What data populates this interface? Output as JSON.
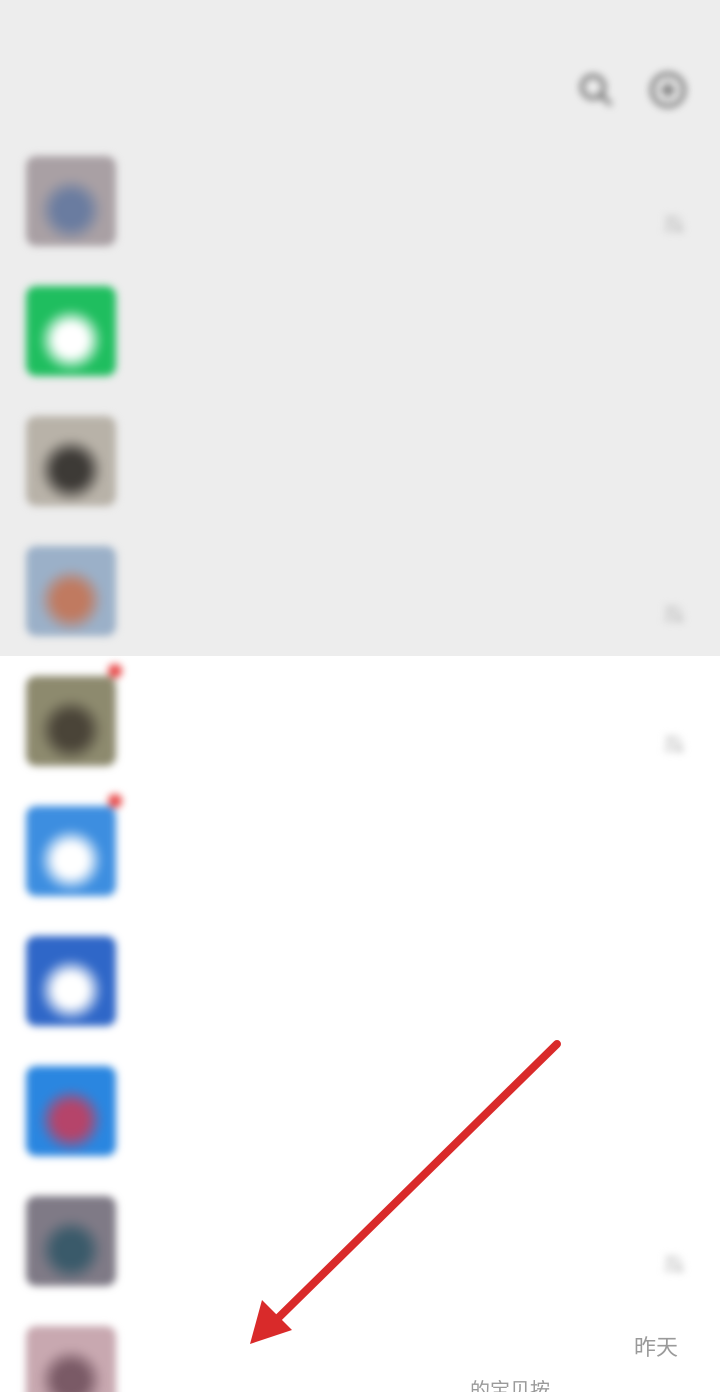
{
  "status_bar": {
    "time": "",
    "right": ""
  },
  "header": {
    "title": "",
    "back": ""
  },
  "chats": [
    {
      "name": "",
      "preview": "",
      "time": "",
      "pinned": true,
      "muted": true,
      "avatar_color": "#a9a0a4",
      "avatar_accent": "#6a7ca0"
    },
    {
      "name": "",
      "preview": "",
      "time": "",
      "pinned": true,
      "muted": false,
      "avatar_color": "#1fbe5f",
      "avatar_accent": "#ffffff"
    },
    {
      "name": "",
      "preview": "",
      "time": "",
      "pinned": true,
      "muted": false,
      "avatar_color": "#b8b2a8",
      "avatar_accent": "#3d3a36"
    },
    {
      "name": "",
      "preview": "",
      "time": "",
      "pinned": true,
      "muted": true,
      "avatar_color": "#9bb0c8",
      "avatar_accent": "#c07a60"
    },
    {
      "name": "",
      "preview": "",
      "time": "",
      "pinned": false,
      "muted": true,
      "unread_dot": true,
      "avatar_color": "#8d8a6e",
      "avatar_accent": "#4a4438"
    },
    {
      "name": "",
      "preview": "",
      "time": "",
      "pinned": false,
      "muted": false,
      "unread_dot": true,
      "avatar_color": "#3d8ee0",
      "avatar_accent": "#ffffff"
    },
    {
      "name": "",
      "preview": "",
      "time": "",
      "pinned": false,
      "muted": false,
      "name_blue": true,
      "avatar_color": "#2f67c8",
      "avatar_accent": "#ffffff"
    },
    {
      "name": "",
      "preview": "",
      "time": "",
      "pinned": false,
      "muted": false,
      "name_blue": true,
      "avatar_color": "#2a86e0",
      "avatar_accent": "#b5446a"
    },
    {
      "name": "",
      "preview": "",
      "time": "",
      "pinned": false,
      "muted": true,
      "avatar_color": "#7f7a86",
      "avatar_accent": "#3a5a6a"
    },
    {
      "name": "",
      "preview": "",
      "time": "",
      "pinned": false,
      "muted": false,
      "avatar_color": "#c8a8b0",
      "avatar_accent": "#7a5a66"
    }
  ],
  "last_chat": {
    "time": "昨天",
    "preview": "…的宝贝按…"
  },
  "colors": {
    "pinned_background": "#ededed",
    "list_background": "#ffffff",
    "annotation_arrow": "#d92a2a"
  }
}
